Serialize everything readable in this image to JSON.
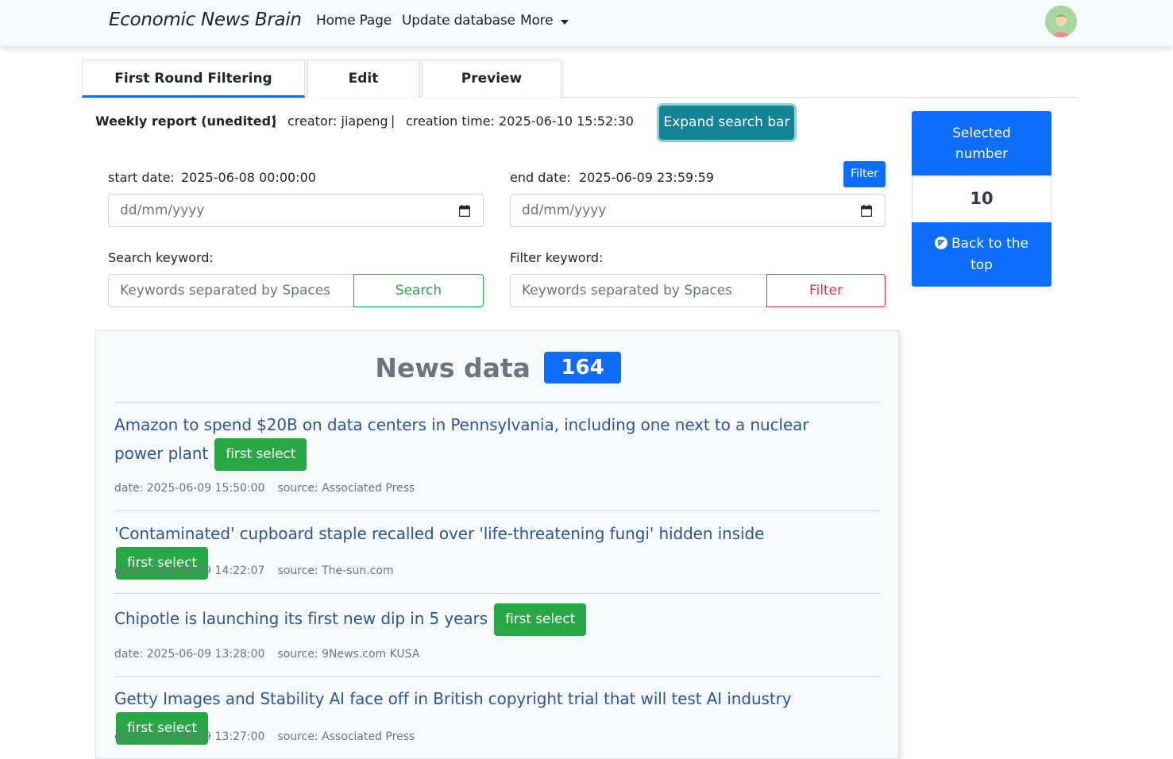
{
  "navbar": {
    "brand": "Economic News Brain",
    "links": {
      "home": "Home Page",
      "update": "Update database",
      "more": "More"
    }
  },
  "tabs": [
    "First Round Filtering",
    "Edit",
    "Preview"
  ],
  "report": {
    "title": "Weekly report (unedited)",
    "separator": "|",
    "creator": "creator: jiapeng",
    "creation_time": "creation time: 2025-06-10 15:52:30",
    "expand_button": "Expand search bar"
  },
  "form": {
    "start_label": "start date:",
    "start_value": "2025-06-08 00:00:00",
    "end_label": "end date:",
    "end_value": "2025-06-09 23:59:59",
    "date_placeholder": "dd/mm/yyyy",
    "filter_small": "Filter",
    "search_label": "Search keyword:",
    "filter_label": "Filter keyword:",
    "keyword_placeholder": "Keywords separated by Spaces",
    "search_button": "Search",
    "filter_button": "Filter"
  },
  "sidebar": {
    "selected_label": "Selected number",
    "selected_count": "10",
    "back_to_top": "Back to the top"
  },
  "news": {
    "heading": "News data",
    "count": "164",
    "select_label": "first select",
    "items": [
      {
        "title": "Amazon to spend $20B on data centers in Pennsylvania, including one next to a nuclear power plant",
        "date": "date: 2025-06-09 15:50:00",
        "source": "source: Associated Press"
      },
      {
        "title": "'Contaminated' cupboard staple recalled over 'life-threatening fungi' hidden inside",
        "date": "date: 2025-06-09 14:22:07",
        "source": "source: The-sun.com"
      },
      {
        "title": "Chipotle is launching its first new dip in 5 years",
        "date": "date: 2025-06-09 13:28:00",
        "source": "source: 9News.com KUSA"
      },
      {
        "title": "Getty Images and Stability AI face off in British copyright trial that will test AI industry",
        "date": "date: 2025-06-09 13:27:00",
        "source": "source: Associated Press"
      }
    ]
  },
  "colors": {
    "primary": "#0d6efd",
    "success": "#28a745",
    "danger": "#dc3545",
    "info_dark": "#138496",
    "link": "#2b5797"
  }
}
